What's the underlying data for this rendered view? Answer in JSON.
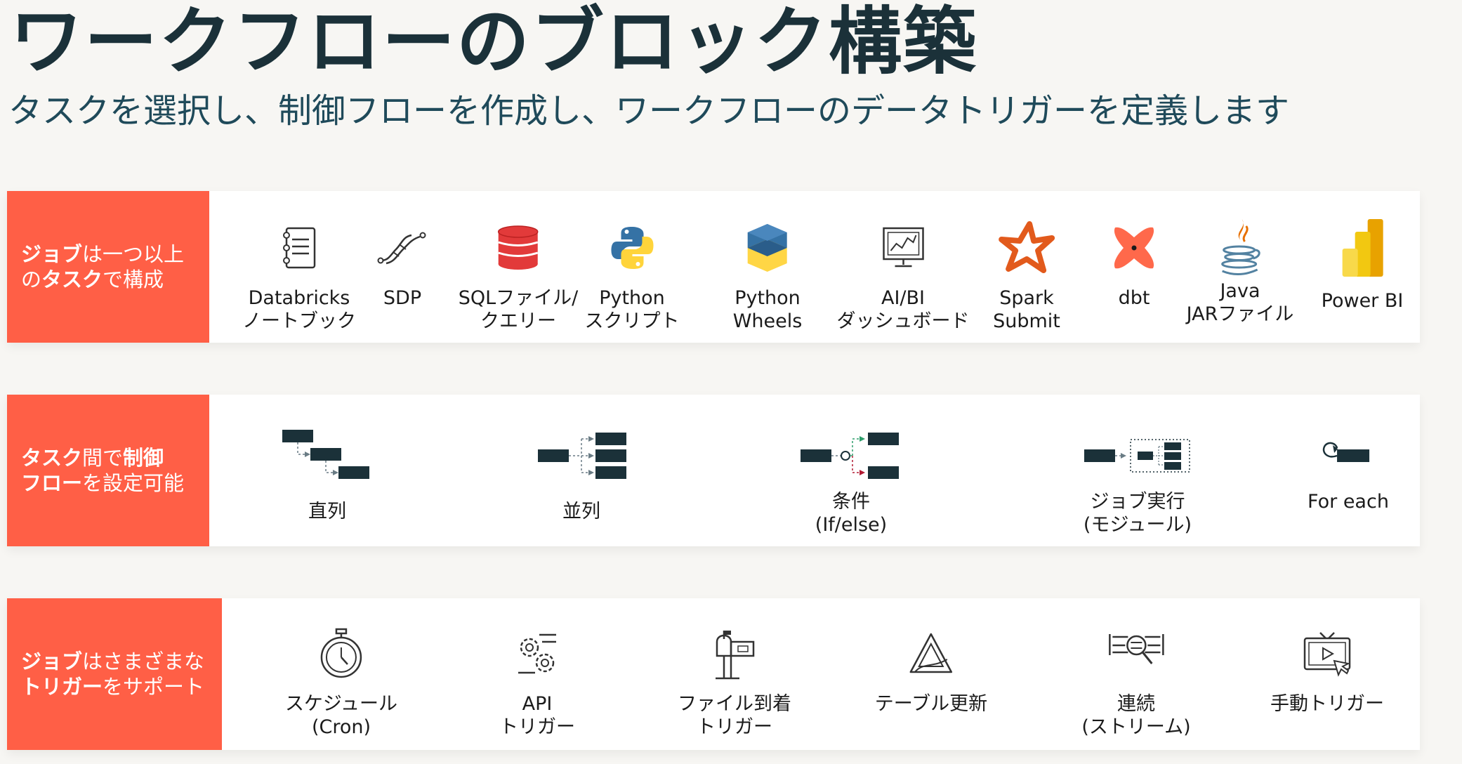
{
  "header": {
    "title": "ワークフローのブロック構築",
    "subtitle": "タスクを選択し、制御フローを作成し、ワークフローのデータトリガーを定義します"
  },
  "rows": [
    {
      "label": {
        "l1_bold": "ジョブ",
        "l1_rest": "は一つ以上",
        "l2_pre": "の",
        "l2_bold": "タスク",
        "l2_rest": "で構成"
      },
      "items": [
        {
          "icon": "notebook-icon",
          "line1": "Databricks",
          "line2": "ノートブック"
        },
        {
          "icon": "pipeline-icon",
          "line1": "SDP",
          "line2": ""
        },
        {
          "icon": "database-icon",
          "line1": "SQLファイル/",
          "line2": "クエリー"
        },
        {
          "icon": "python-logo-icon",
          "line1": "Python",
          "line2": "スクリプト"
        },
        {
          "icon": "python-wheel-icon",
          "line1": "Python",
          "line2": "Wheels"
        },
        {
          "icon": "dashboard-icon",
          "line1": "AI/BI",
          "line2": "ダッシュボード"
        },
        {
          "icon": "spark-star-icon",
          "line1": "Spark",
          "line2": "Submit"
        },
        {
          "icon": "dbt-icon",
          "line1": "dbt",
          "line2": ""
        },
        {
          "icon": "java-icon",
          "line1": "Java",
          "line2": "JARファイル"
        },
        {
          "icon": "powerbi-icon",
          "line1": "Power BI",
          "line2": ""
        }
      ]
    },
    {
      "label": {
        "l1_bold": "タスク",
        "l1_rest": "間で",
        "l1_bold2": "制御",
        "l2_bold": "フロー",
        "l2_rest": "を設定可能"
      },
      "items": [
        {
          "icon": "sequential-flow-icon",
          "line1": "直列",
          "line2": ""
        },
        {
          "icon": "parallel-flow-icon",
          "line1": "並列",
          "line2": ""
        },
        {
          "icon": "conditional-flow-icon",
          "line1": "条件",
          "line2": "(If/else)"
        },
        {
          "icon": "run-job-icon",
          "line1": "ジョブ実行",
          "line2": "(モジュール)"
        },
        {
          "icon": "for-each-icon",
          "line1": "For each",
          "line2": ""
        }
      ]
    },
    {
      "label": {
        "l1_bold": "ジョブ",
        "l1_rest": "はさまざまな",
        "l2_bold": "トリガー",
        "l2_rest": "をサポート"
      },
      "items": [
        {
          "icon": "stopwatch-icon",
          "line1": "スケジュール",
          "line2": "(Cron)"
        },
        {
          "icon": "api-gears-icon",
          "line1": "API",
          "line2": "トリガー"
        },
        {
          "icon": "mailbox-icon",
          "line1": "ファイル到着",
          "line2": "トリガー"
        },
        {
          "icon": "delta-table-icon",
          "line1": "テーブル更新",
          "line2": ""
        },
        {
          "icon": "stream-icon",
          "line1": "連続",
          "line2": "(ストリーム)"
        },
        {
          "icon": "manual-trigger-icon",
          "line1": "手動トリガー",
          "line2": ""
        }
      ]
    }
  ],
  "colors": {
    "accent": "#ff5f46",
    "dark": "#1b3139",
    "python_blue": "#3572a5",
    "python_yellow": "#ffd43b",
    "green": "#2e9e6b",
    "red": "#b31b34"
  }
}
